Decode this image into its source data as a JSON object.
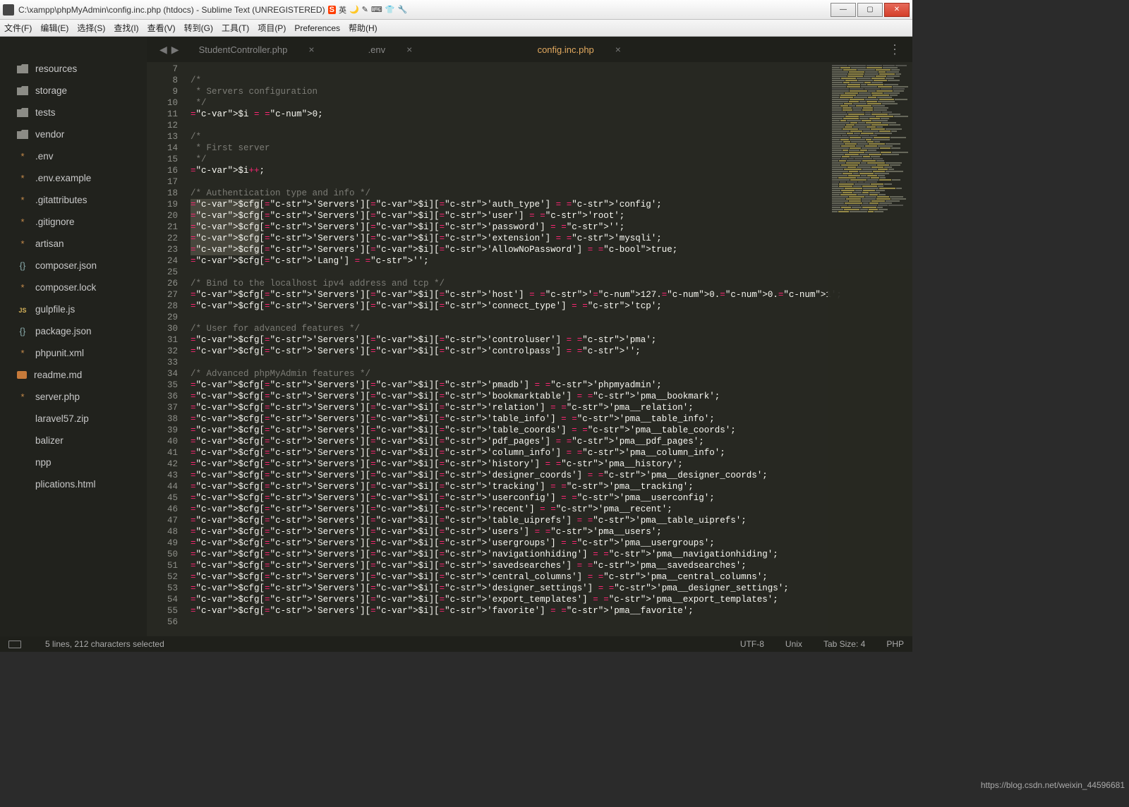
{
  "window": {
    "title": "C:\\xampp\\phpMyAdmin\\config.inc.php (htdocs) - Sublime Text (UNREGISTERED)",
    "ime_tags": [
      "英",
      "🌙",
      "✎",
      "⌨",
      "👕",
      "🔧"
    ]
  },
  "menu": [
    "文件(F)",
    "编辑(E)",
    "选择(S)",
    "查找(I)",
    "查看(V)",
    "转到(G)",
    "工具(T)",
    "项目(P)",
    "Preferences",
    "帮助(H)"
  ],
  "sidebar": {
    "items": [
      {
        "type": "folder",
        "label": "resources"
      },
      {
        "type": "folder",
        "label": "storage"
      },
      {
        "type": "folder",
        "label": "tests"
      },
      {
        "type": "folder",
        "label": "vendor"
      },
      {
        "type": "file",
        "label": ".env"
      },
      {
        "type": "file",
        "label": ".env.example"
      },
      {
        "type": "file",
        "label": ".gitattributes"
      },
      {
        "type": "file",
        "label": ".gitignore"
      },
      {
        "type": "file",
        "label": "artisan"
      },
      {
        "type": "json",
        "label": "composer.json"
      },
      {
        "type": "file",
        "label": "composer.lock"
      },
      {
        "type": "js",
        "label": "gulpfile.js"
      },
      {
        "type": "json",
        "label": "package.json"
      },
      {
        "type": "file",
        "label": "phpunit.xml"
      },
      {
        "type": "md",
        "label": "readme.md"
      },
      {
        "type": "php",
        "label": "server.php"
      },
      {
        "type": "zip",
        "label": "laravel57.zip"
      },
      {
        "type": "zip",
        "label": "balizer"
      },
      {
        "type": "zip",
        "label": "npp"
      },
      {
        "type": "zip",
        "label": "plications.html"
      }
    ]
  },
  "tabs": [
    {
      "label": "StudentController.php",
      "active": false
    },
    {
      "label": ".env",
      "active": false
    },
    {
      "label": "config.inc.php",
      "active": true
    }
  ],
  "gutter_start": 7,
  "gutter_end": 56,
  "highlighted_lines": [
    19,
    20,
    21,
    22,
    23
  ],
  "code_lines": [
    "",
    "/*",
    " * Servers configuration",
    " */",
    "$i = 0;",
    "",
    "/*",
    " * First server",
    " */",
    "$i++;",
    "",
    "/* Authentication type and info */",
    "$cfg['Servers'][$i]['auth_type'] = 'config';",
    "$cfg['Servers'][$i]['user'] = 'root';",
    "$cfg['Servers'][$i]['password'] = '';",
    "$cfg['Servers'][$i]['extension'] = 'mysqli';",
    "$cfg['Servers'][$i]['AllowNoPassword'] = true;",
    "$cfg['Lang'] = '';",
    "",
    "/* Bind to the localhost ipv4 address and tcp */",
    "$cfg['Servers'][$i]['host'] = '127.0.0.1';",
    "$cfg['Servers'][$i]['connect_type'] = 'tcp';",
    "",
    "/* User for advanced features */",
    "$cfg['Servers'][$i]['controluser'] = 'pma';",
    "$cfg['Servers'][$i]['controlpass'] = '';",
    "",
    "/* Advanced phpMyAdmin features */",
    "$cfg['Servers'][$i]['pmadb'] = 'phpmyadmin';",
    "$cfg['Servers'][$i]['bookmarktable'] = 'pma__bookmark';",
    "$cfg['Servers'][$i]['relation'] = 'pma__relation';",
    "$cfg['Servers'][$i]['table_info'] = 'pma__table_info';",
    "$cfg['Servers'][$i]['table_coords'] = 'pma__table_coords';",
    "$cfg['Servers'][$i]['pdf_pages'] = 'pma__pdf_pages';",
    "$cfg['Servers'][$i]['column_info'] = 'pma__column_info';",
    "$cfg['Servers'][$i]['history'] = 'pma__history';",
    "$cfg['Servers'][$i]['designer_coords'] = 'pma__designer_coords';",
    "$cfg['Servers'][$i]['tracking'] = 'pma__tracking';",
    "$cfg['Servers'][$i]['userconfig'] = 'pma__userconfig';",
    "$cfg['Servers'][$i]['recent'] = 'pma__recent';",
    "$cfg['Servers'][$i]['table_uiprefs'] = 'pma__table_uiprefs';",
    "$cfg['Servers'][$i]['users'] = 'pma__users';",
    "$cfg['Servers'][$i]['usergroups'] = 'pma__usergroups';",
    "$cfg['Servers'][$i]['navigationhiding'] = 'pma__navigationhiding';",
    "$cfg['Servers'][$i]['savedsearches'] = 'pma__savedsearches';",
    "$cfg['Servers'][$i]['central_columns'] = 'pma__central_columns';",
    "$cfg['Servers'][$i]['designer_settings'] = 'pma__designer_settings';",
    "$cfg['Servers'][$i]['export_templates'] = 'pma__export_templates';",
    "$cfg['Servers'][$i]['favorite'] = 'pma__favorite';",
    ""
  ],
  "status": {
    "selection": "5 lines, 212 characters selected",
    "encoding": "UTF-8",
    "line_ending": "Unix",
    "tab": "Tab Size: 4",
    "syntax": "PHP"
  },
  "watermark": "https://blog.csdn.net/weixin_44596681"
}
